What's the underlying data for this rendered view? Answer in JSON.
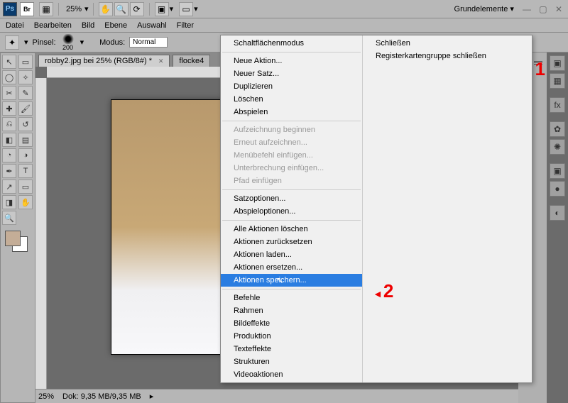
{
  "topbar": {
    "ps_badge": "Ps",
    "br_badge": "Br",
    "zoom": "25%",
    "workspace": "Grundelemente"
  },
  "menubar": [
    "Datei",
    "Bearbeiten",
    "Bild",
    "Ebene",
    "Auswahl",
    "Filter"
  ],
  "options": {
    "brush_label": "Pinsel:",
    "brush_size": "200",
    "mode_label": "Modus:",
    "mode_value": "Normal"
  },
  "tabs": [
    {
      "title": "robby2.jpg bei 25% (RGB/8#) *",
      "active": true
    },
    {
      "title": "flocke4",
      "active": false
    }
  ],
  "status": {
    "zoom": "25%",
    "dok": "Dok: 9,35 MB/9,35 MB"
  },
  "context_col1": [
    {
      "label": "Schaltflächenmodus",
      "enabled": true
    },
    {
      "sep": true
    },
    {
      "label": "Neue Aktion...",
      "enabled": true
    },
    {
      "label": "Neuer Satz...",
      "enabled": true
    },
    {
      "label": "Duplizieren",
      "enabled": true
    },
    {
      "label": "Löschen",
      "enabled": true
    },
    {
      "label": "Abspielen",
      "enabled": true
    },
    {
      "sep": true
    },
    {
      "label": "Aufzeichnung beginnen",
      "enabled": false
    },
    {
      "label": "Erneut aufzeichnen...",
      "enabled": false
    },
    {
      "label": "Menübefehl einfügen...",
      "enabled": false
    },
    {
      "label": "Unterbrechung einfügen...",
      "enabled": false
    },
    {
      "label": "Pfad einfügen",
      "enabled": false
    },
    {
      "sep": true
    },
    {
      "label": "Satzoptionen...",
      "enabled": true
    },
    {
      "label": "Abspieloptionen...",
      "enabled": true
    },
    {
      "sep": true
    },
    {
      "label": "Alle Aktionen löschen",
      "enabled": true
    },
    {
      "label": "Aktionen zurücksetzen",
      "enabled": true
    },
    {
      "label": "Aktionen laden...",
      "enabled": true
    },
    {
      "label": "Aktionen ersetzen...",
      "enabled": true
    },
    {
      "label": "Aktionen speichern...",
      "enabled": true,
      "highlighted": true
    },
    {
      "sep": true
    },
    {
      "label": "Befehle",
      "enabled": true
    },
    {
      "label": "Rahmen",
      "enabled": true
    },
    {
      "label": "Bildeffekte",
      "enabled": true
    },
    {
      "label": "Produktion",
      "enabled": true
    },
    {
      "label": "Texteffekte",
      "enabled": true
    },
    {
      "label": "Strukturen",
      "enabled": true
    },
    {
      "label": "Videoaktionen",
      "enabled": true
    }
  ],
  "context_col2": [
    {
      "label": "Schließen",
      "enabled": true
    },
    {
      "label": "Registerkartengruppe schließen",
      "enabled": true
    }
  ],
  "markers": {
    "one": "1",
    "two": "2"
  }
}
